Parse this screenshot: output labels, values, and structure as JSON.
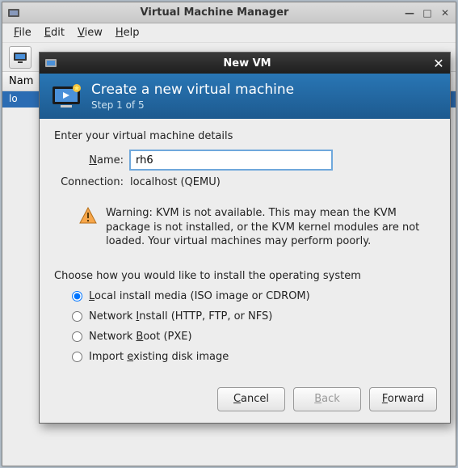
{
  "main_window": {
    "title": "Virtual Machine Manager",
    "menu": {
      "file": "File",
      "edit": "Edit",
      "view": "View",
      "help": "Help"
    },
    "list": {
      "header_name": "Nam",
      "row0": "lo"
    }
  },
  "dialog": {
    "title": "New VM",
    "header": {
      "title": "Create a new virtual machine",
      "step": "Step 1 of 5"
    },
    "details_section": "Enter your virtual machine details",
    "name_label": "Name:",
    "name_value": "rh6",
    "connection_label": "Connection:",
    "connection_value": "localhost (QEMU)",
    "warning": "Warning: KVM is not available. This may mean the KVM package is not installed, or the KVM kernel modules are not loaded. Your virtual machines may perform poorly.",
    "install_section": "Choose how you would like to install the operating system",
    "options": {
      "local": "Local install media (ISO image or CDROM)",
      "network": "Network Install (HTTP, FTP, or NFS)",
      "boot": "Network Boot (PXE)",
      "import": "Import existing disk image"
    },
    "buttons": {
      "cancel": "Cancel",
      "back": "Back",
      "forward": "Forward"
    }
  }
}
